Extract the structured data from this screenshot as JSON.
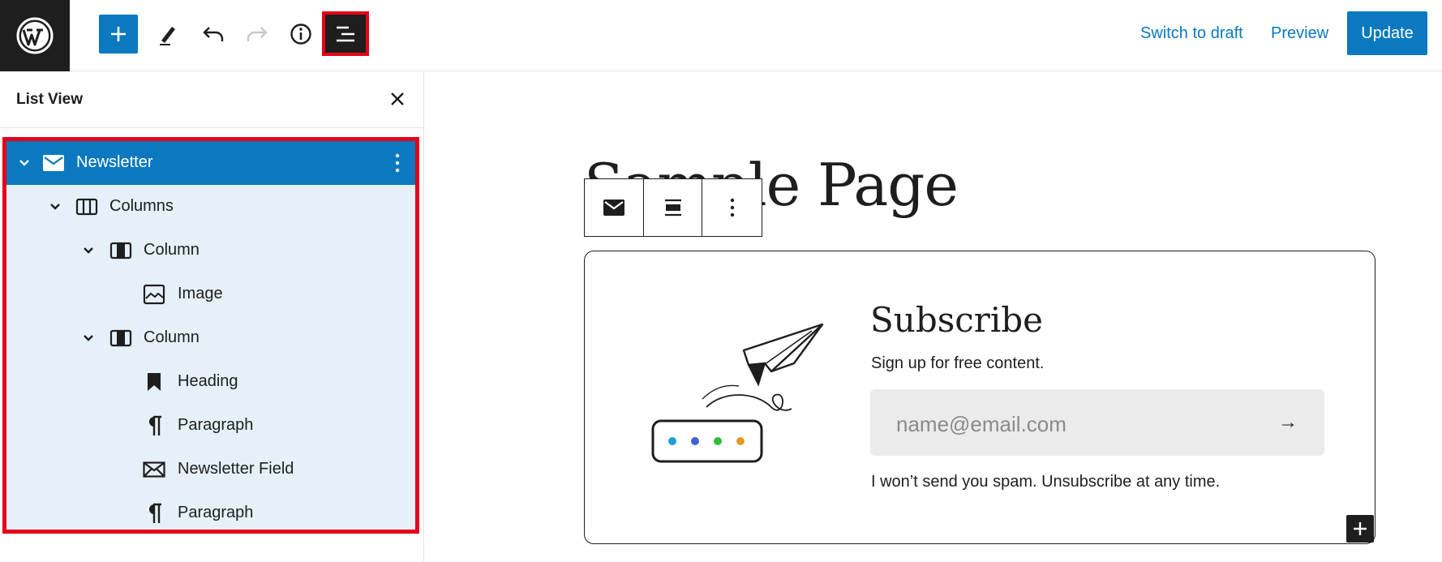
{
  "header": {
    "logo": "wordpress-logo",
    "switch_to_draft": "Switch to draft",
    "preview": "Preview",
    "update": "Update"
  },
  "list_view": {
    "title": "List View",
    "items": [
      {
        "label": "Newsletter",
        "icon": "envelope-icon",
        "level": 0,
        "expanded": true,
        "selected": true
      },
      {
        "label": "Columns",
        "icon": "columns-icon",
        "level": 1,
        "expanded": true
      },
      {
        "label": "Column",
        "icon": "column-icon",
        "level": 2,
        "expanded": true
      },
      {
        "label": "Image",
        "icon": "image-icon",
        "level": 3
      },
      {
        "label": "Column",
        "icon": "column-icon",
        "level": 2,
        "expanded": true
      },
      {
        "label": "Heading",
        "icon": "bookmark-icon",
        "level": 3
      },
      {
        "label": "Paragraph",
        "icon": "pilcrow-icon",
        "level": 3
      },
      {
        "label": "Newsletter Field",
        "icon": "mail-field-icon",
        "level": 3
      },
      {
        "label": "Paragraph",
        "icon": "pilcrow-icon",
        "level": 3
      }
    ]
  },
  "canvas": {
    "page_title": "Sample Page",
    "subscribe": {
      "heading": "Subscribe",
      "text": "Sign up for free content.",
      "email_placeholder": "name@email.com",
      "submit_arrow": "→",
      "disclaimer": "I won’t send you spam. Unsubscribe at any time."
    }
  },
  "colors": {
    "accent": "#0a79bf",
    "highlight": "#e6001a",
    "tree_bg": "#e5f0f8",
    "dark": "#1e1e1e"
  }
}
